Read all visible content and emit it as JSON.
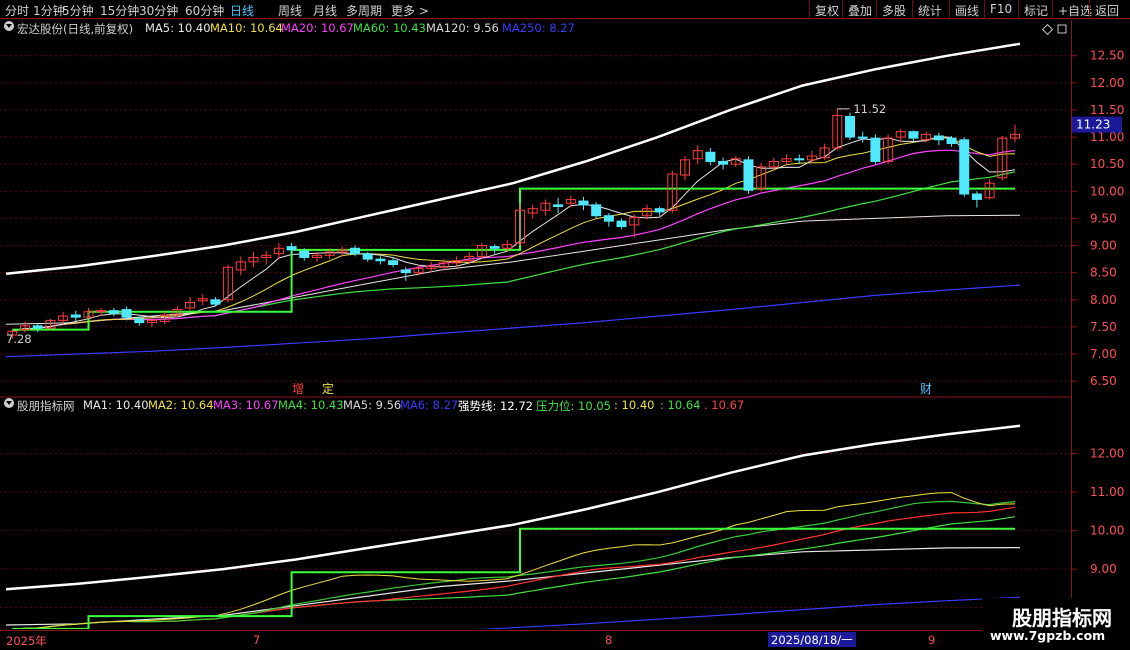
{
  "toolbar": {
    "left": [
      "分时",
      "1分钟",
      "5分钟",
      "15分钟",
      "30分钟",
      "60分钟",
      "日线",
      "周线",
      "月线",
      "多周期",
      "更多 >"
    ],
    "active": "日线",
    "right": [
      "复权",
      "叠加",
      "多股",
      "统计",
      "画线",
      "F10",
      "标记",
      "+自选",
      "返回"
    ]
  },
  "main_legend": {
    "stock": "宏达股份(日线,前复权)",
    "items": [
      {
        "label": "MA5: 10.40",
        "color": "#e8e8e8"
      },
      {
        "label": "MA10: 10.64",
        "color": "#f0e040"
      },
      {
        "label": "MA20: 10.67",
        "color": "#ff40ff"
      },
      {
        "label": "MA60: 10.43",
        "color": "#40e040"
      },
      {
        "label": "MA120: 9.56",
        "color": "#d8d8d8"
      },
      {
        "label": "MA250: 8.27",
        "color": "#3a3aff"
      }
    ]
  },
  "sub_legend": {
    "name": "股朋指标网",
    "items": [
      {
        "label": "MA1: 10.40",
        "color": "#e8e8e8"
      },
      {
        "label": "MA2: 10.64",
        "color": "#f0e040"
      },
      {
        "label": "MA3: 10.67",
        "color": "#ff40ff"
      },
      {
        "label": "MA4: 10.43",
        "color": "#40e040"
      },
      {
        "label": "MA5: 9.56",
        "color": "#d8d8d8"
      },
      {
        "label": "MA6: 8.27",
        "color": "#3a3aff"
      },
      {
        "label": "强势线: 12.72",
        "color": "#ffffff"
      },
      {
        "label": "压力位: 10.05",
        "color": "#40e040"
      },
      {
        "label": ": 10.40",
        "color": "#f0e040"
      },
      {
        "label": ": 10.64",
        "color": "#40e040"
      },
      {
        "label": ". 10.67",
        "color": "#ff4040"
      }
    ]
  },
  "markers": {
    "zeng": "增",
    "ding": "定",
    "cai": "财",
    "high": "11.52",
    "low": "7.28",
    "current_price": "11.23"
  },
  "x_axis": {
    "year": "2025年",
    "months": [
      "7",
      "8",
      "9"
    ],
    "cursor_date": "2025/08/18/一"
  },
  "watermark": {
    "title": "股朋指标网",
    "url": "www.7gpzb.com"
  },
  "colors": {
    "up": "#ff3c3c",
    "down": "#4fe8ff",
    "grid": "#5a0a0a",
    "axis": "#8a1515"
  },
  "chart_data": [
    {
      "type": "candlestick",
      "title": "宏达股份(日线,前复权)",
      "y_ticks": [
        6.5,
        7.0,
        7.5,
        8.0,
        8.5,
        9.0,
        9.5,
        10.0,
        10.5,
        11.0,
        11.5,
        12.0,
        12.5
      ],
      "y_tick_labels": [
        "6.50",
        "7.00",
        "7.50",
        "8.00",
        "8.50",
        "9.00",
        "9.50",
        "10.00",
        "10.50",
        "11.00",
        "11.50",
        "12.00",
        "12.50"
      ],
      "ylim": [
        6.3,
        12.9
      ],
      "candles": [
        [
          7.35,
          7.42,
          7.28,
          7.45
        ],
        [
          7.45,
          7.52,
          7.4,
          7.6
        ],
        [
          7.52,
          7.48,
          7.4,
          7.55
        ],
        [
          7.48,
          7.62,
          7.45,
          7.65
        ],
        [
          7.62,
          7.7,
          7.55,
          7.78
        ],
        [
          7.72,
          7.68,
          7.6,
          7.8
        ],
        [
          7.68,
          7.78,
          7.65,
          7.85
        ],
        [
          7.78,
          7.8,
          7.7,
          7.85
        ],
        [
          7.8,
          7.75,
          7.7,
          7.85
        ],
        [
          7.82,
          7.68,
          7.62,
          7.88
        ],
        [
          7.65,
          7.58,
          7.52,
          7.7
        ],
        [
          7.58,
          7.62,
          7.5,
          7.68
        ],
        [
          7.6,
          7.72,
          7.55,
          7.78
        ],
        [
          7.72,
          7.82,
          7.68,
          7.88
        ],
        [
          7.85,
          7.95,
          7.8,
          8.05
        ],
        [
          7.98,
          8.02,
          7.9,
          8.1
        ],
        [
          8.0,
          7.92,
          7.88,
          8.05
        ],
        [
          8.0,
          8.6,
          7.95,
          8.65
        ],
        [
          8.55,
          8.7,
          8.45,
          8.8
        ],
        [
          8.7,
          8.78,
          8.6,
          8.88
        ],
        [
          8.78,
          8.82,
          8.65,
          8.9
        ],
        [
          8.85,
          8.95,
          8.75,
          9.05
        ],
        [
          8.98,
          8.92,
          8.85,
          9.05
        ],
        [
          8.9,
          8.78,
          8.72,
          8.95
        ],
        [
          8.78,
          8.82,
          8.7,
          8.88
        ],
        [
          8.82,
          8.88,
          8.75,
          8.95
        ],
        [
          8.88,
          8.92,
          8.8,
          8.98
        ],
        [
          8.95,
          8.85,
          8.8,
          9.0
        ],
        [
          8.85,
          8.75,
          8.7,
          8.88
        ],
        [
          8.75,
          8.72,
          8.65,
          8.8
        ],
        [
          8.72,
          8.65,
          8.6,
          8.78
        ],
        [
          8.55,
          8.5,
          8.35,
          8.6
        ],
        [
          8.5,
          8.58,
          8.45,
          8.65
        ],
        [
          8.58,
          8.62,
          8.5,
          8.7
        ],
        [
          8.6,
          8.68,
          8.55,
          8.75
        ],
        [
          8.68,
          8.72,
          8.6,
          8.8
        ],
        [
          8.72,
          8.8,
          8.65,
          8.88
        ],
        [
          8.8,
          9.0,
          8.75,
          9.05
        ],
        [
          8.98,
          8.95,
          8.85,
          9.02
        ],
        [
          8.95,
          9.02,
          8.9,
          9.1
        ],
        [
          9.05,
          9.65,
          9.0,
          9.78
        ],
        [
          9.6,
          9.68,
          9.5,
          9.75
        ],
        [
          9.65,
          9.78,
          9.55,
          9.85
        ],
        [
          9.75,
          9.72,
          9.6,
          9.88
        ],
        [
          9.78,
          9.85,
          9.7,
          9.92
        ],
        [
          9.82,
          9.75,
          9.65,
          9.9
        ],
        [
          9.75,
          9.55,
          9.5,
          9.8
        ],
        [
          9.55,
          9.45,
          9.35,
          9.6
        ],
        [
          9.45,
          9.35,
          9.3,
          9.5
        ],
        [
          9.38,
          9.52,
          9.15,
          9.58
        ],
        [
          9.55,
          9.68,
          9.48,
          9.75
        ],
        [
          9.68,
          9.62,
          9.55,
          9.72
        ],
        [
          9.65,
          10.32,
          9.6,
          10.38
        ],
        [
          10.3,
          10.58,
          10.2,
          10.65
        ],
        [
          10.6,
          10.75,
          10.5,
          10.85
        ],
        [
          10.72,
          10.55,
          10.48,
          10.8
        ],
        [
          10.55,
          10.5,
          10.4,
          10.62
        ],
        [
          10.5,
          10.6,
          10.45,
          10.65
        ],
        [
          10.58,
          10.02,
          9.95,
          10.65
        ],
        [
          10.05,
          10.45,
          10.0,
          10.52
        ],
        [
          10.45,
          10.55,
          10.38,
          10.62
        ],
        [
          10.55,
          10.6,
          10.48,
          10.68
        ],
        [
          10.6,
          10.58,
          10.5,
          10.68
        ],
        [
          10.58,
          10.65,
          10.52,
          10.75
        ],
        [
          10.62,
          10.8,
          10.58,
          10.88
        ],
        [
          10.8,
          11.4,
          10.75,
          11.52
        ],
        [
          11.38,
          11.0,
          10.95,
          11.45
        ],
        [
          11.0,
          10.98,
          10.9,
          11.1
        ],
        [
          10.98,
          10.55,
          10.5,
          11.05
        ],
        [
          10.55,
          10.98,
          10.5,
          11.05
        ],
        [
          11.0,
          11.1,
          10.9,
          11.15
        ],
        [
          11.1,
          10.98,
          10.9,
          11.12
        ],
        [
          10.95,
          11.05,
          10.9,
          11.1
        ],
        [
          11.02,
          10.95,
          10.85,
          11.08
        ],
        [
          10.98,
          10.88,
          10.82,
          11.02
        ],
        [
          10.95,
          9.95,
          9.9,
          11.0
        ],
        [
          9.95,
          9.85,
          9.7,
          10.0
        ],
        [
          9.88,
          10.15,
          9.85,
          10.22
        ],
        [
          10.25,
          10.98,
          10.2,
          11.02
        ],
        [
          10.98,
          11.05,
          10.9,
          11.23
        ]
      ]
    },
    {
      "type": "line",
      "title": "股朋指标网",
      "y_ticks": [
        8.0,
        9.0,
        10.0,
        11.0,
        12.0
      ],
      "y_tick_labels": [
        "8.00",
        "9.00",
        "10.00",
        "11.00",
        "12.00"
      ],
      "ylim": [
        7.55,
        13.0
      ],
      "x": [
        "2025年",
        "7",
        "8",
        "9"
      ],
      "lines": [
        {
          "color": "#ffffff",
          "values": [
            8.48,
            8.62,
            8.8,
            9.0,
            9.25,
            9.55,
            9.85,
            10.15,
            10.55,
            11.0,
            11.5,
            11.95,
            12.25,
            12.5,
            12.72
          ]
        },
        {
          "color": "#e8e8e8",
          "values": [
            7.55,
            7.58,
            7.7,
            7.8,
            8.05,
            8.3,
            8.55,
            8.7,
            8.9,
            9.1,
            9.3,
            9.45,
            9.5,
            9.55,
            9.56
          ]
        },
        {
          "color": "#3a3aff",
          "values": [
            6.95,
            7.0,
            7.05,
            7.12,
            7.2,
            7.28,
            7.38,
            7.48,
            7.58,
            7.7,
            7.82,
            7.95,
            8.08,
            8.18,
            8.27
          ]
        }
      ]
    }
  ]
}
